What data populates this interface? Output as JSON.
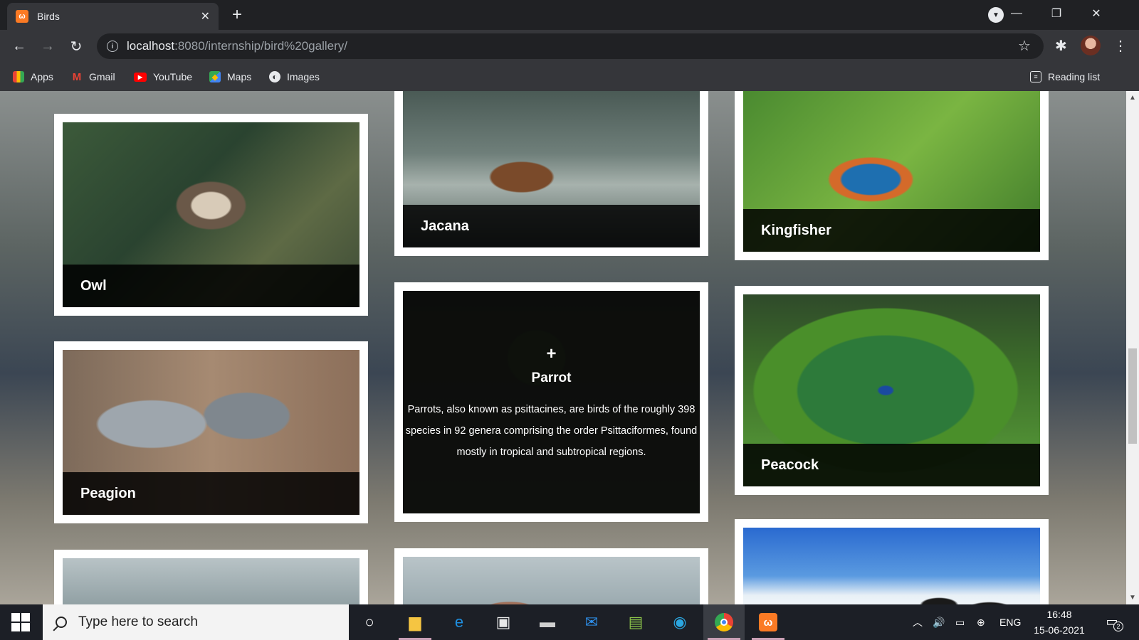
{
  "browser": {
    "tab_title": "Birds",
    "tab_close": "✕",
    "new_tab": "+",
    "url_host": "localhost",
    "url_rest": ":8080/internship/bird%20gallery/",
    "bookmarks": [
      {
        "label": "Apps"
      },
      {
        "label": "Gmail"
      },
      {
        "label": "YouTube"
      },
      {
        "label": "Maps"
      },
      {
        "label": "Images"
      }
    ],
    "reading_list": "Reading list"
  },
  "gallery": {
    "owl": "Owl",
    "jacana": "Jacana",
    "kingfisher": "Kingfisher",
    "pigeon": "Peagion",
    "parrot": {
      "plus": "+",
      "name": "Parrot",
      "description": "Parrots, also known as psittacines, are birds of the roughly 398 species in 92 genera comprising the order Psittaciformes, found mostly in tropical and subtropical regions."
    },
    "peacock": "Peacock"
  },
  "taskbar": {
    "search_placeholder": "Type here to search",
    "language": "ENG",
    "time": "16:48",
    "date": "15-06-2021",
    "notifications": "2"
  },
  "colors": {
    "brand_xampp": "#fb7a24",
    "chrome_dark": "#202124",
    "chrome_toolbar": "#35363a",
    "caption_bg": "#000000"
  }
}
